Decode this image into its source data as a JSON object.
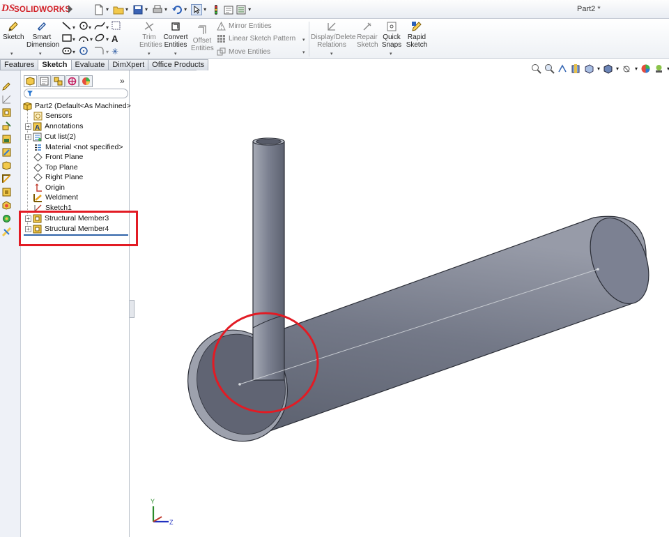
{
  "app": {
    "brand_prefix": "DS",
    "brand_name": "SOLIDWORKS",
    "document_title": "Part2 *"
  },
  "colors": {
    "brand_red": "#d2232a",
    "annotation_red": "#e21b24",
    "model_gray": "#6b7080",
    "rollback_blue": "#2f63a8"
  },
  "quick_access": [
    {
      "icon": "new-document-icon"
    },
    {
      "icon": "open-folder-icon"
    },
    {
      "icon": "save-icon"
    },
    {
      "icon": "print-icon"
    },
    {
      "icon": "undo-icon"
    },
    {
      "icon": "select-pointer-icon"
    },
    {
      "icon": "rebuild-icon"
    },
    {
      "icon": "file-properties-icon"
    },
    {
      "icon": "options-icon"
    }
  ],
  "command_manager": {
    "sketch": "Sketch",
    "smart_dimension_1": "Smart",
    "smart_dimension_2": "Dimension",
    "trim_1": "Trim",
    "trim_2": "Entities",
    "convert_1": "Convert",
    "convert_2": "Entities",
    "offset_1": "Offset",
    "offset_2": "Entities",
    "mirror": "Mirror Entities",
    "linear_pattern": "Linear Sketch Pattern",
    "move": "Move Entities",
    "display_delete_1": "Display/Delete",
    "display_delete_2": "Relations",
    "repair_1": "Repair",
    "repair_2": "Sketch",
    "quick_snaps_1": "Quick",
    "quick_snaps_2": "Snaps",
    "rapid_1": "Rapid",
    "rapid_2": "Sketch"
  },
  "tabs": [
    {
      "label": "Features",
      "active": false
    },
    {
      "label": "Sketch",
      "active": true
    },
    {
      "label": "Evaluate",
      "active": false
    },
    {
      "label": "DimXpert",
      "active": false
    },
    {
      "label": "Office Products",
      "active": false
    }
  ],
  "feature_tree": {
    "root": "Part2  (Default<As Machined>",
    "items": [
      {
        "label": "Sensors",
        "icon": "sensors-icon",
        "expandable": false
      },
      {
        "label": "Annotations",
        "icon": "annotations-icon",
        "expandable": true
      },
      {
        "label": "Cut list(2)",
        "icon": "cut-list-icon",
        "expandable": true
      },
      {
        "label": "Material <not specified>",
        "icon": "material-icon",
        "expandable": false
      },
      {
        "label": "Front Plane",
        "icon": "plane-icon",
        "expandable": false
      },
      {
        "label": "Top Plane",
        "icon": "plane-icon",
        "expandable": false
      },
      {
        "label": "Right Plane",
        "icon": "plane-icon",
        "expandable": false
      },
      {
        "label": "Origin",
        "icon": "origin-icon",
        "expandable": false
      },
      {
        "label": "Weldment",
        "icon": "weldment-icon",
        "expandable": false
      },
      {
        "label": "Sketch1",
        "icon": "sketch-icon",
        "expandable": false
      },
      {
        "label": "Structural Member3",
        "icon": "structural-member-icon",
        "expandable": true
      },
      {
        "label": "Structural Member4",
        "icon": "structural-member-icon",
        "expandable": true
      }
    ]
  },
  "triad": {
    "y_label": "Y",
    "z_label": "Z"
  }
}
